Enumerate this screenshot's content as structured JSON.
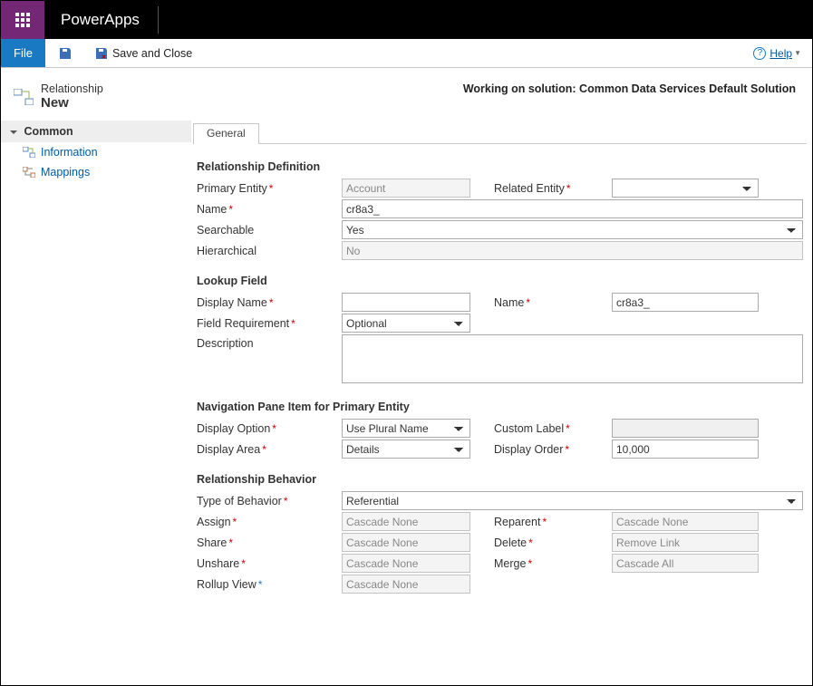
{
  "brand": {
    "app_name": "PowerApps"
  },
  "toolbar": {
    "file_label": "File",
    "saveclose_label": "Save and Close"
  },
  "help": {
    "label": "Help"
  },
  "header": {
    "type_label": "Relationship",
    "title": "New",
    "solution_text": "Working on solution: Common Data Services Default Solution"
  },
  "sidebar": {
    "group_label": "Common",
    "items": [
      {
        "label": "Information"
      },
      {
        "label": "Mappings"
      }
    ]
  },
  "tab": {
    "label": "General"
  },
  "sections": {
    "definition": {
      "heading": "Relationship Definition",
      "primary_entity_label": "Primary Entity",
      "primary_entity_value": "Account",
      "related_entity_label": "Related Entity",
      "related_entity_value": "",
      "name_label": "Name",
      "name_value": "cr8a3_",
      "searchable_label": "Searchable",
      "searchable_value": "Yes",
      "hierarchical_label": "Hierarchical",
      "hierarchical_value": "No"
    },
    "lookup": {
      "heading": "Lookup Field",
      "display_name_label": "Display Name",
      "display_name_value": "",
      "name_label": "Name",
      "name_value": "cr8a3_",
      "field_requirement_label": "Field Requirement",
      "field_requirement_value": "Optional",
      "description_label": "Description",
      "description_value": ""
    },
    "navigation": {
      "heading": "Navigation Pane Item for Primary Entity",
      "display_option_label": "Display Option",
      "display_option_value": "Use Plural Name",
      "custom_label_label": "Custom Label",
      "custom_label_value": "",
      "display_area_label": "Display Area",
      "display_area_value": "Details",
      "display_order_label": "Display Order",
      "display_order_value": "10,000"
    },
    "behavior": {
      "heading": "Relationship Behavior",
      "type_label": "Type of Behavior",
      "type_value": "Referential",
      "assign_label": "Assign",
      "assign_value": "Cascade None",
      "reparent_label": "Reparent",
      "reparent_value": "Cascade None",
      "share_label": "Share",
      "share_value": "Cascade None",
      "delete_label": "Delete",
      "delete_value": "Remove Link",
      "unshare_label": "Unshare",
      "unshare_value": "Cascade None",
      "merge_label": "Merge",
      "merge_value": "Cascade All",
      "rollup_label": "Rollup View",
      "rollup_value": "Cascade None"
    }
  }
}
